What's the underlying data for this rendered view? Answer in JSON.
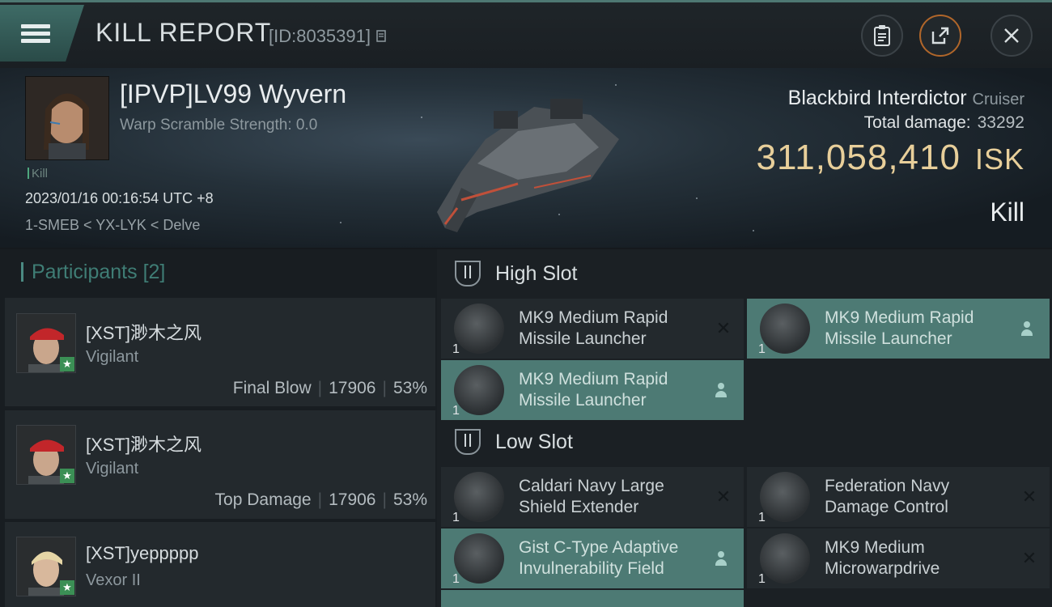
{
  "header": {
    "title": "KILL REPORT",
    "kill_id": "[ID:8035391]",
    "icons": [
      "menu-icon",
      "clipboard-icon",
      "share-icon",
      "close-icon"
    ]
  },
  "victim": {
    "name": "[IPVP]LV99 Wyvern",
    "warp_scramble": "Warp Scramble Strength: 0.0",
    "kill_tag": "Kill",
    "datetime": "2023/01/16 00:16:54 UTC +8",
    "location": "1-SMEB < YX-LYK < Delve"
  },
  "ship": {
    "name": "Blackbird Interdictor",
    "class": "Cruiser",
    "total_damage_label": "Total damage:",
    "total_damage": "33292",
    "isk_value": "311,058,410",
    "isk_unit": "ISK",
    "result": "Kill"
  },
  "participants": {
    "header": "Participants",
    "count": "[2]",
    "rows": [
      {
        "name": "[XST]渺木之风",
        "ship": "Vigilant",
        "label": "Final Blow",
        "damage": "17906",
        "percent": "53%"
      },
      {
        "name": "[XST]渺木之风",
        "ship": "Vigilant",
        "label": "Top Damage",
        "damage": "17906",
        "percent": "53%"
      },
      {
        "name": "[XST]yeppppp",
        "ship": "Vexor II",
        "label": "",
        "damage": "",
        "percent": ""
      }
    ],
    "badge": "★"
  },
  "fittings": {
    "high_slot_label": "High Slot",
    "low_slot_label": "Low Slot",
    "high": [
      {
        "qty": "1",
        "name_l1": "MK9 Medium Rapid",
        "name_l2": "Missile Launcher",
        "state": "destroyed"
      },
      {
        "qty": "1",
        "name_l1": "MK9 Medium Rapid",
        "name_l2": "Missile Launcher",
        "state": "dropped"
      },
      {
        "qty": "1",
        "name_l1": "MK9 Medium Rapid",
        "name_l2": "Missile Launcher",
        "state": "dropped"
      }
    ],
    "low": [
      {
        "qty": "1",
        "name_l1": "Caldari Navy Large",
        "name_l2": "Shield Extender",
        "state": "destroyed"
      },
      {
        "qty": "1",
        "name_l1": "Federation Navy",
        "name_l2": "Damage Control",
        "state": "destroyed"
      },
      {
        "qty": "1",
        "name_l1": "Gist C-Type Adaptive",
        "name_l2": "Invulnerability Field",
        "state": "dropped"
      },
      {
        "qty": "1",
        "name_l1": "MK9 Medium",
        "name_l2": "Microwarpdrive",
        "state": "destroyed"
      }
    ],
    "destroyed_glyph": "✕"
  }
}
